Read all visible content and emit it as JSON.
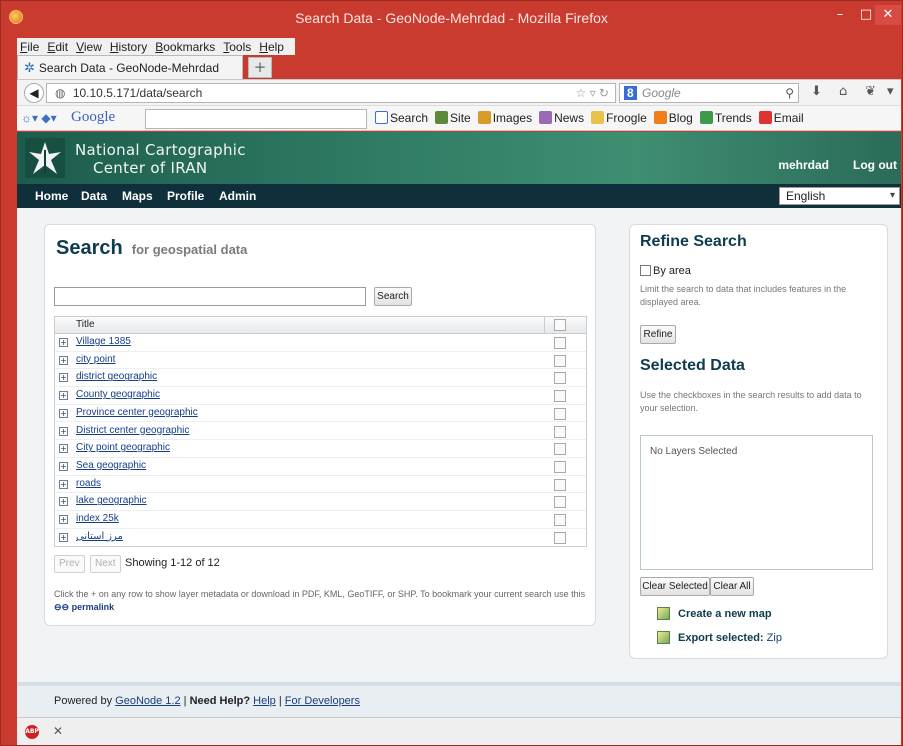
{
  "browser": {
    "window_title": "Search Data - GeoNode-Mehrdad - Mozilla Firefox",
    "menu": [
      "File",
      "Edit",
      "View",
      "History",
      "Bookmarks",
      "Tools",
      "Help"
    ],
    "tab_title": "Search Data - GeoNode-Mehrdad",
    "new_tab": "+",
    "url": "10.10.5.171/data/search",
    "search_engine": "Google",
    "search_placeholder": "Google"
  },
  "google_bar": {
    "logo": "Google",
    "items": [
      "Search",
      "Site",
      "Images",
      "News",
      "Froogle",
      "Blog",
      "Trends",
      "Email"
    ]
  },
  "site": {
    "org_line1": "National Cartographic",
    "org_line2": "Center of IRAN",
    "user": "mehrdad",
    "logout": "Log out",
    "nav": [
      "Home",
      "Data",
      "Maps",
      "Profile",
      "Admin"
    ],
    "language": "English"
  },
  "search": {
    "heading": "Search",
    "subheading": "for geospatial data",
    "query": "",
    "search_button": "Search",
    "column_title": "Title",
    "results": [
      "Village 1385",
      "city point",
      "district geographic",
      "County geographic",
      "Province center geographic",
      "District center geographic",
      "City point geographic",
      "Sea geographic",
      "roads",
      "lake geographic",
      "index 25k",
      "مرز استانی"
    ],
    "prev": "Prev",
    "next": "Next",
    "showing": "Showing 1-12 of 12",
    "help": "Click the + on any row to show layer metadata or download in PDF, KML, GeoTIFF, or SHP. To bookmark your current search use this",
    "permalink": "permalink"
  },
  "refine": {
    "heading": "Refine Search",
    "by_area": "By area",
    "by_area_desc": "Limit the search to data that includes features in the displayed area.",
    "refine_button": "Refine",
    "selected_heading": "Selected Data",
    "selected_desc": "Use the checkboxes in the search results to add data to your selection.",
    "no_layers": "No Layers Selected",
    "clear_selected": "Clear Selected",
    "clear_all": "Clear All",
    "create_map": "Create a new map",
    "export_label": "Export selected:",
    "export_zip": "Zip"
  },
  "footer": {
    "powered_by": "Powered by",
    "geonode": "GeoNode 1.2",
    "sep1": "|",
    "need_help": "Need Help?",
    "help": "Help",
    "sep2": "|",
    "developers": "For Developers"
  },
  "colors": {
    "window_frame": "#c93a2f",
    "banner": "#2f7b64",
    "nav_bg": "#0f2f3a",
    "heading": "#0f3b4e",
    "link": "#153d8a"
  }
}
